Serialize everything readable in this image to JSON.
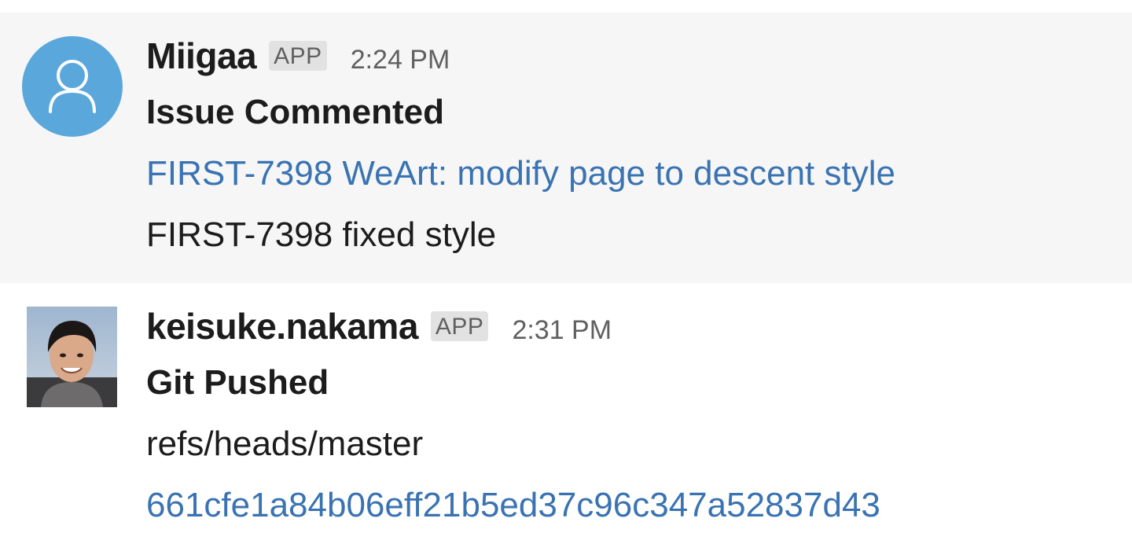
{
  "messages": [
    {
      "sender": "Miigaa",
      "badge": "APP",
      "time": "2:24 PM",
      "avatar": "user-silhouette-icon",
      "title": "Issue Commented",
      "link": "FIRST-7398 WeArt: modify page to descent style",
      "text": "FIRST-7398 fixed style"
    },
    {
      "sender": "keisuke.nakama",
      "badge": "APP",
      "time": "2:31 PM",
      "avatar": "profile-photo",
      "title": "Git Pushed",
      "text": "refs/heads/master",
      "link": "661cfe1a84b06eff21b5ed37c96c347a52837d43"
    }
  ],
  "colors": {
    "link": "#3a73b2",
    "hover_bg": "#f6f6f6",
    "avatar_bg": "#5aa7dc",
    "badge_bg": "#e2e2e2"
  }
}
